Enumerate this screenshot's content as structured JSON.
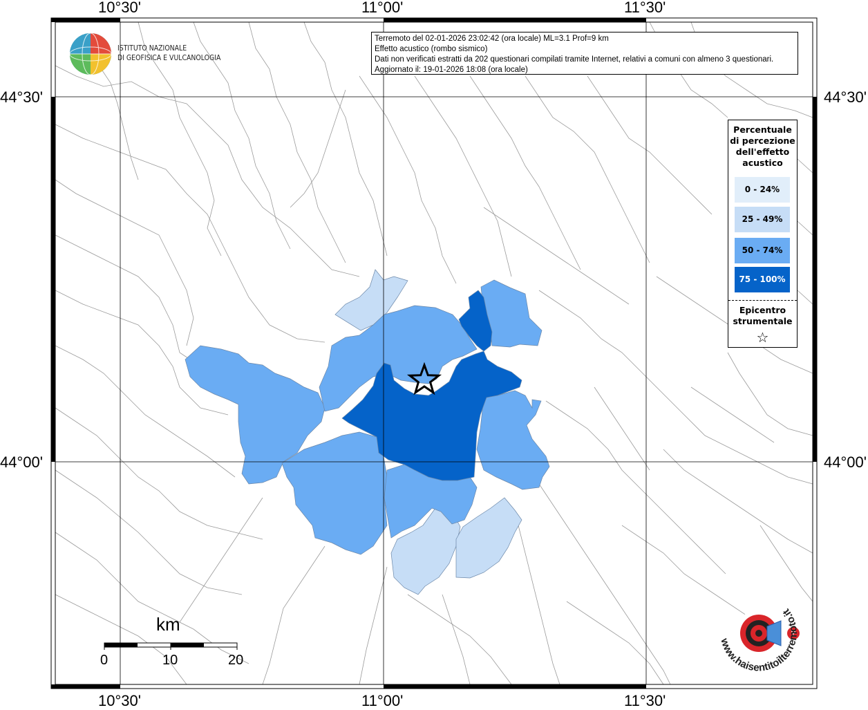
{
  "coords": {
    "lon_labels": [
      "10°30'",
      "11°00'",
      "11°30'"
    ],
    "lat_labels": [
      "44°30'",
      "44°00'"
    ]
  },
  "logo": {
    "line1": "ISTITUTO NAZIONALE",
    "line2": "DI GEOFISICA E VULCANOLOGIA"
  },
  "info": {
    "line1": "Terremoto del 02-01-2026 23:02:42 (ora locale) ML=3.1 Prof=9 km",
    "line2": "Effetto acustico (rombo sismico)",
    "line3": "Dati non verificati estratti da 202 questionari compilati tramite Internet, relativi a comuni con almeno 3 questionari.",
    "line4": "Aggiornato il: 19-01-2026 18:08 (ora locale)"
  },
  "legend": {
    "title_lines": [
      "Percentuale",
      "di percezione",
      "dell'effetto",
      "acustico"
    ],
    "classes": [
      {
        "label": "0 - 24%",
        "color": "#e1eefa"
      },
      {
        "label": "25 - 49%",
        "color": "#c6ddf6"
      },
      {
        "label": "50 - 74%",
        "color": "#6aacf3"
      },
      {
        "label": "75 - 100%",
        "color": "#0563c9"
      }
    ],
    "epicenter_lines": [
      "Epicentro",
      "strumentale"
    ],
    "epicenter_symbol": "☆"
  },
  "scale": {
    "unit": "km",
    "labels": [
      "0",
      "10",
      "20"
    ]
  },
  "badge": {
    "text": "www.haisentitoilterremoto.it",
    "colors": {
      "red": "#d9252a",
      "blue": "#2a5fae"
    }
  }
}
